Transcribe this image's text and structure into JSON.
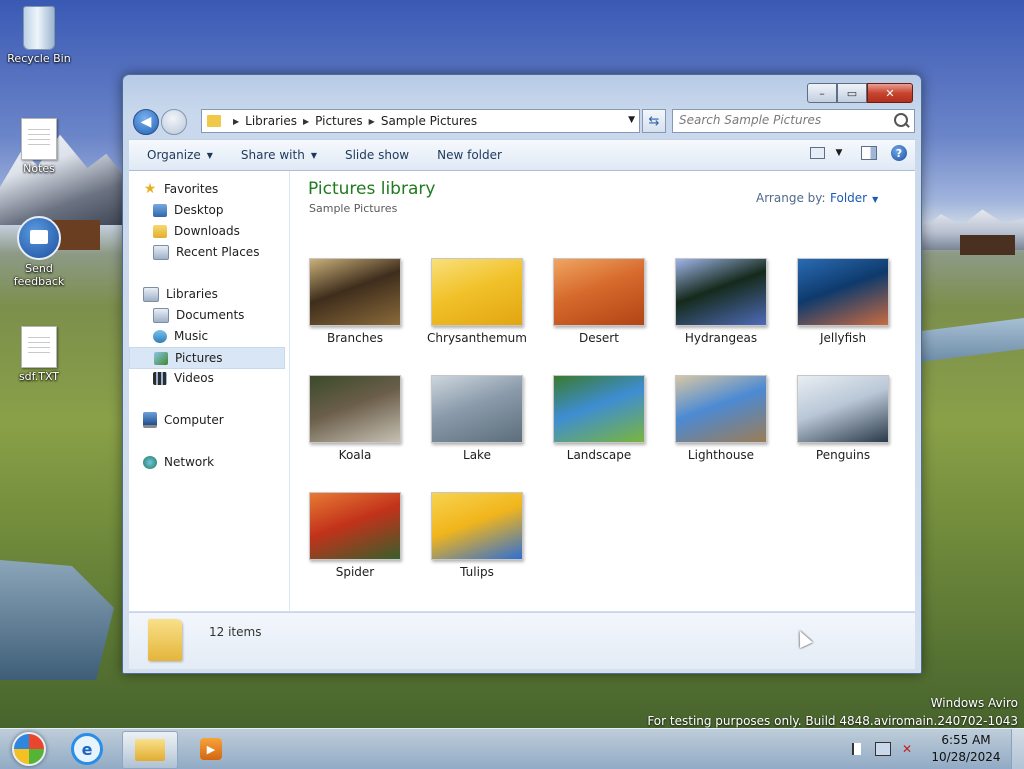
{
  "desktop": {
    "icons": [
      {
        "label": "Recycle Bin",
        "icon": "recycle-bin-icon"
      },
      {
        "label": "Notes",
        "icon": "text-document-icon"
      },
      {
        "label": "Send feedback",
        "icon": "feedback-icon"
      },
      {
        "label": "sdf.TXT",
        "icon": "text-document-icon"
      }
    ],
    "watermark": {
      "line1": "Windows Aviro",
      "line2": "For testing purposes only. Build 4848.aviromain.240702-1043"
    }
  },
  "window": {
    "buttons": {
      "minimize": "–",
      "maximize": "▭",
      "close": "✕"
    },
    "nav": {
      "back": "◀"
    },
    "address": {
      "crumbs": [
        "Libraries",
        "Pictures",
        "Sample Pictures"
      ],
      "separator": "▶"
    },
    "search": {
      "placeholder": "Search Sample Pictures"
    },
    "toolbar": {
      "items": [
        "Organize",
        "Share with",
        "Slide show",
        "New folder"
      ],
      "caret": "▼"
    },
    "nav_pane": {
      "groups": [
        {
          "label": "Favorites",
          "icon": "star-icon",
          "children": [
            "Desktop",
            "Downloads",
            "Recent Places"
          ]
        },
        {
          "label": "Libraries",
          "icon": "libraries-icon",
          "children": [
            "Documents",
            "Music",
            "Pictures",
            "Videos"
          ]
        },
        {
          "label": "Computer",
          "icon": "computer-icon",
          "children": []
        },
        {
          "label": "Network",
          "icon": "network-icon",
          "children": []
        }
      ],
      "selected": "Pictures"
    },
    "content": {
      "title": "Pictures library",
      "subtitle": "Sample Pictures",
      "arrange_label": "Arrange by:",
      "arrange_value": "Folder",
      "items": [
        {
          "name": "Branches",
          "colors": [
            "#3f2d1c",
            "#8a6a3a",
            "#c9b07a"
          ]
        },
        {
          "name": "Chrysanthemum",
          "colors": [
            "#f1c22b",
            "#e2a511",
            "#f9e07a"
          ]
        },
        {
          "name": "Desert",
          "colors": [
            "#d6692c",
            "#b14515",
            "#f0a561"
          ]
        },
        {
          "name": "Hydrangeas",
          "colors": [
            "#152a1b",
            "#4e6bb8",
            "#9fb5e8"
          ]
        },
        {
          "name": "Jellyfish",
          "colors": [
            "#0e3a6c",
            "#c96b42",
            "#2a6bb4"
          ]
        },
        {
          "name": "Koala",
          "colors": [
            "#6b5e4a",
            "#c6c0b3",
            "#3b4a2b"
          ]
        },
        {
          "name": "Lake",
          "colors": [
            "#8a9aaa",
            "#5c6d7b",
            "#cdd6de"
          ]
        },
        {
          "name": "Landscape",
          "colors": [
            "#3e8dd3",
            "#7ab53d",
            "#3a7a2d"
          ]
        },
        {
          "name": "Lighthouse",
          "colors": [
            "#4c8ad3",
            "#9b7c55",
            "#d7c6a5"
          ]
        },
        {
          "name": "Penguins",
          "colors": [
            "#b9c7d6",
            "#2b3a4a",
            "#e8eef3"
          ]
        },
        {
          "name": "Spider",
          "colors": [
            "#c2321b",
            "#3a5e2b",
            "#e77a33"
          ]
        },
        {
          "name": "Tulips",
          "colors": [
            "#f1b51c",
            "#2f6fd3",
            "#f7d34f"
          ]
        }
      ]
    },
    "details": {
      "count": "12 items"
    }
  },
  "taskbar": {
    "apps": [
      {
        "name": "Internet Explorer",
        "icon": "internet-explorer-icon",
        "glyph": "e"
      },
      {
        "name": "Windows Explorer",
        "icon": "folder-icon",
        "glyph": ""
      },
      {
        "name": "Windows Media Player",
        "icon": "media-player-icon",
        "glyph": "▶"
      }
    ],
    "tray": {
      "flag": "⚑",
      "net": "▤",
      "volume": "✕"
    },
    "clock": {
      "time": "6:55 AM",
      "date": "10/28/2024"
    }
  }
}
